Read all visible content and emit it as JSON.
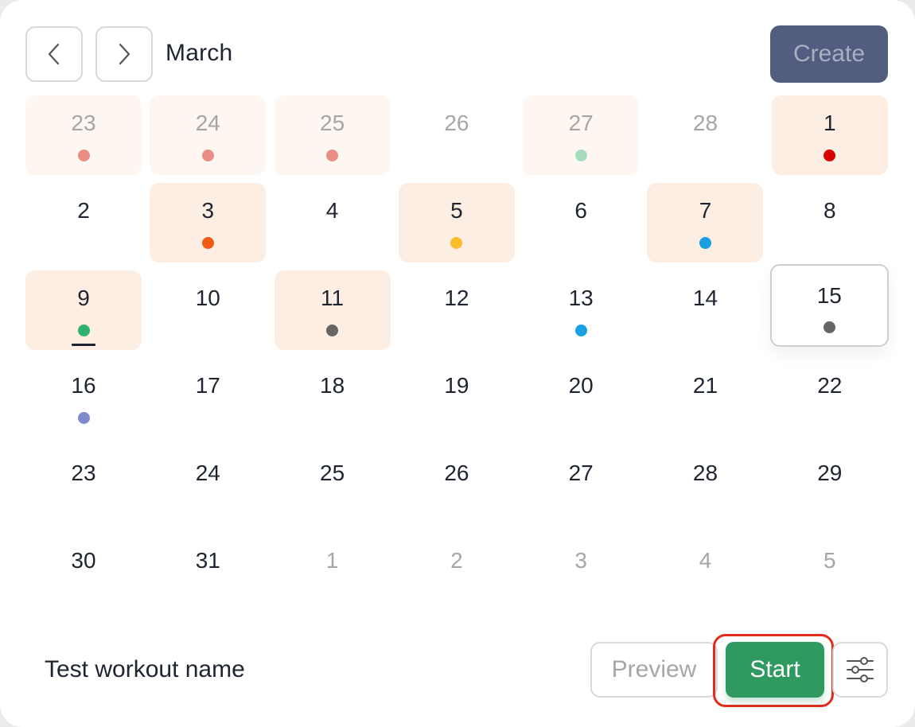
{
  "header": {
    "prev_icon": "chevron-left-icon",
    "next_icon": "chevron-right-icon",
    "month": "March",
    "create_label": "Create"
  },
  "colors": {
    "highlight_bg": "#fdeee4",
    "create_bg": "#525d80",
    "start_bg": "#2e9a5f",
    "focus_ring": "#e22c1e"
  },
  "calendar": {
    "days": [
      {
        "label": "23",
        "dim": true,
        "highlight": "faint",
        "dot": "#ea8e86"
      },
      {
        "label": "24",
        "dim": true,
        "highlight": "faint",
        "dot": "#ea8e86"
      },
      {
        "label": "25",
        "dim": true,
        "highlight": "faint",
        "dot": "#ea8e86"
      },
      {
        "label": "26",
        "dim": true,
        "highlight": null,
        "dot": null
      },
      {
        "label": "27",
        "dim": true,
        "highlight": "faint",
        "dot": "#a6dcbc"
      },
      {
        "label": "28",
        "dim": true,
        "highlight": null,
        "dot": null
      },
      {
        "label": "1",
        "dim": false,
        "highlight": "strong",
        "dot": "#d90000"
      },
      {
        "label": "2",
        "dim": false,
        "highlight": null,
        "dot": null
      },
      {
        "label": "3",
        "dim": false,
        "highlight": "strong",
        "dot": "#f05a14"
      },
      {
        "label": "4",
        "dim": false,
        "highlight": null,
        "dot": null
      },
      {
        "label": "5",
        "dim": false,
        "highlight": "strong",
        "dot": "#fbbd2e"
      },
      {
        "label": "6",
        "dim": false,
        "highlight": null,
        "dot": null
      },
      {
        "label": "7",
        "dim": false,
        "highlight": "strong",
        "dot": "#1a9fe0"
      },
      {
        "label": "8",
        "dim": false,
        "highlight": null,
        "dot": null
      },
      {
        "label": "9",
        "dim": false,
        "highlight": "strong",
        "dot": "#2fb16e",
        "today": true
      },
      {
        "label": "10",
        "dim": false,
        "highlight": null,
        "dot": null
      },
      {
        "label": "11",
        "dim": false,
        "highlight": "strong",
        "dot": "#656565"
      },
      {
        "label": "12",
        "dim": false,
        "highlight": null,
        "dot": null
      },
      {
        "label": "13",
        "dim": false,
        "highlight": null,
        "dot": "#1a9fe0"
      },
      {
        "label": "14",
        "dim": false,
        "highlight": null,
        "dot": null
      },
      {
        "label": "15",
        "dim": false,
        "highlight": null,
        "dot": "#656565",
        "selected": true
      },
      {
        "label": "16",
        "dim": false,
        "highlight": null,
        "dot": "#8089cc"
      },
      {
        "label": "17",
        "dim": false,
        "highlight": null,
        "dot": null
      },
      {
        "label": "18",
        "dim": false,
        "highlight": null,
        "dot": null
      },
      {
        "label": "19",
        "dim": false,
        "highlight": null,
        "dot": null
      },
      {
        "label": "20",
        "dim": false,
        "highlight": null,
        "dot": null
      },
      {
        "label": "21",
        "dim": false,
        "highlight": null,
        "dot": null
      },
      {
        "label": "22",
        "dim": false,
        "highlight": null,
        "dot": null
      },
      {
        "label": "23",
        "dim": false,
        "highlight": null,
        "dot": null
      },
      {
        "label": "24",
        "dim": false,
        "highlight": null,
        "dot": null
      },
      {
        "label": "25",
        "dim": false,
        "highlight": null,
        "dot": null
      },
      {
        "label": "26",
        "dim": false,
        "highlight": null,
        "dot": null
      },
      {
        "label": "27",
        "dim": false,
        "highlight": null,
        "dot": null
      },
      {
        "label": "28",
        "dim": false,
        "highlight": null,
        "dot": null
      },
      {
        "label": "29",
        "dim": false,
        "highlight": null,
        "dot": null
      },
      {
        "label": "30",
        "dim": false,
        "highlight": null,
        "dot": null
      },
      {
        "label": "31",
        "dim": false,
        "highlight": null,
        "dot": null
      },
      {
        "label": "1",
        "dim": true,
        "highlight": null,
        "dot": null
      },
      {
        "label": "2",
        "dim": true,
        "highlight": null,
        "dot": null
      },
      {
        "label": "3",
        "dim": true,
        "highlight": null,
        "dot": null
      },
      {
        "label": "4",
        "dim": true,
        "highlight": null,
        "dot": null
      },
      {
        "label": "5",
        "dim": true,
        "highlight": null,
        "dot": null
      }
    ]
  },
  "footer": {
    "workout_name": "Test workout name",
    "preview_label": "Preview",
    "start_label": "Start",
    "settings_icon": "sliders-icon"
  }
}
